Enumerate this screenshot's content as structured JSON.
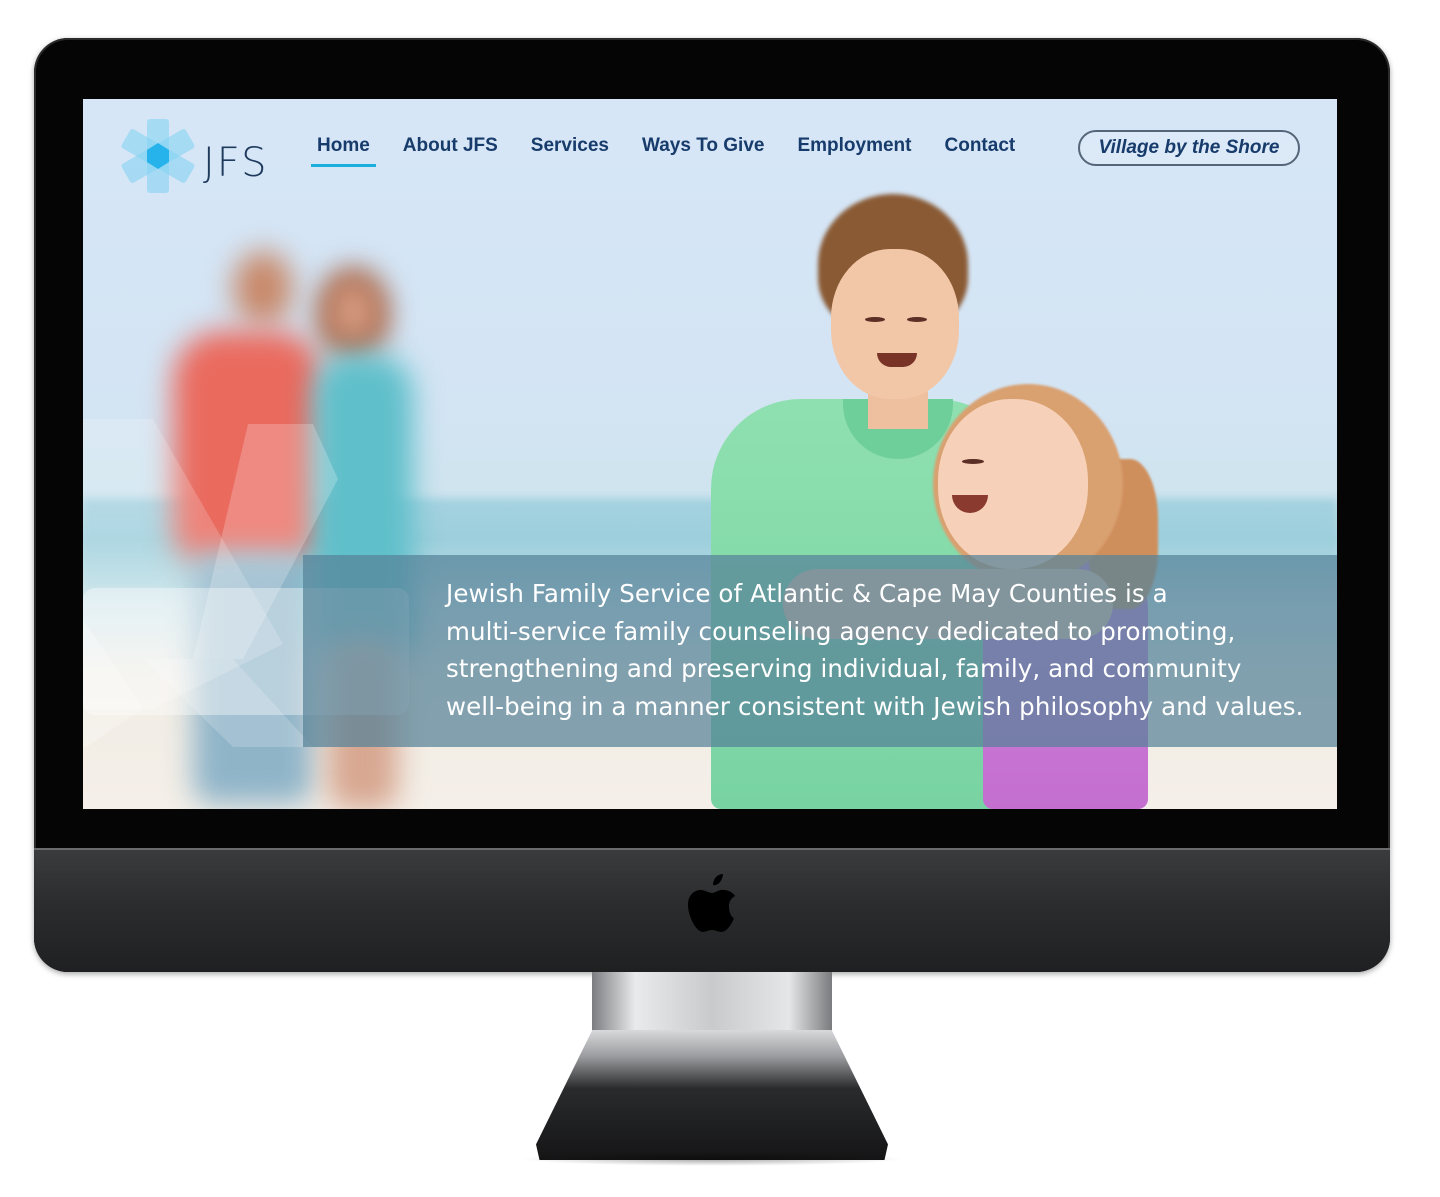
{
  "brand": {
    "logo_text": "JFS",
    "logo_icon": "star-asterisk-logo-icon",
    "colors": {
      "navy": "#173b6a",
      "accent": "#1aaedc",
      "logo_light": "#9fdcf4"
    }
  },
  "nav": {
    "items": [
      {
        "label": "Home",
        "active": true
      },
      {
        "label": "About JFS"
      },
      {
        "label": "Services"
      },
      {
        "label": "Ways To Give"
      },
      {
        "label": "Employment"
      },
      {
        "label": "Contact"
      }
    ],
    "cta_label": "Village by the Shore"
  },
  "hero": {
    "mission_lines": [
      "Jewish Family Service of Atlantic & Cape May Counties is a",
      "multi-service family counseling agency dedicated to promoting,",
      "strengthening and preserving individual, family, and community",
      "well-being in a manner consistent with Jewish philosophy and values."
    ]
  },
  "device": {
    "logo_icon": "apple-logo-icon"
  }
}
